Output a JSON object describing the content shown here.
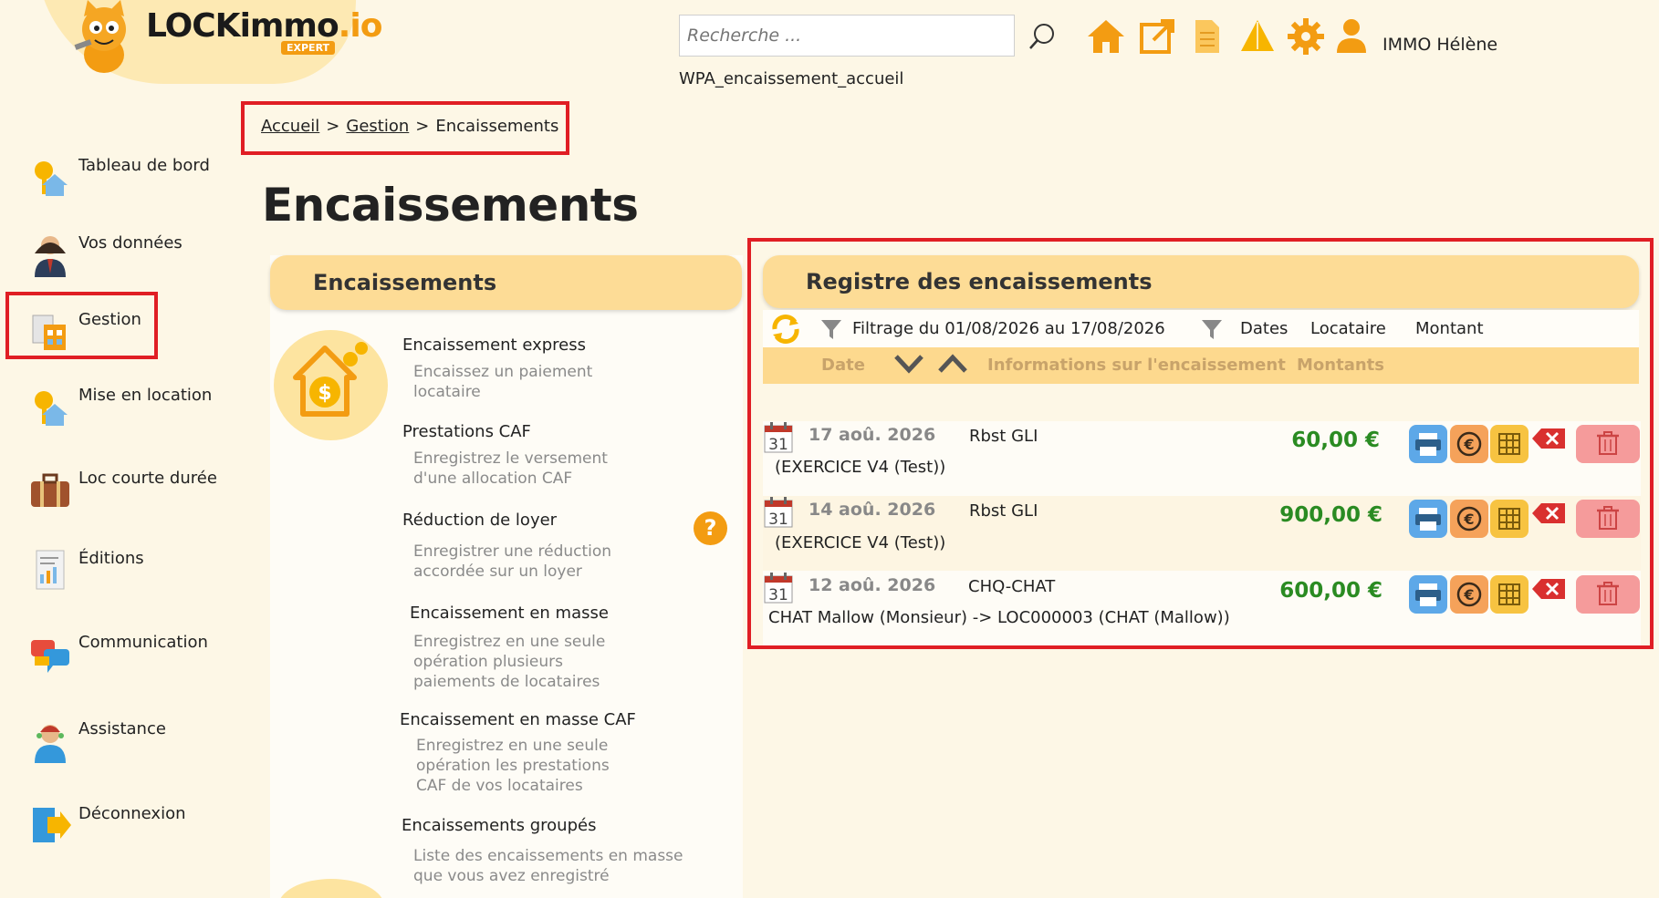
{
  "brand": {
    "name_main": "LOCKimmo",
    "name_suffix": ".io",
    "badge": "EXPERT"
  },
  "header": {
    "search_placeholder": "Recherche ...",
    "user_name": "IMMO Hélène",
    "page_code": "WPA_encaissement_accueil"
  },
  "breadcrumb": {
    "home": "Accueil",
    "section": "Gestion",
    "current": "Encaissements",
    "separator": ">"
  },
  "page_title": "Encaissements",
  "sidebar": {
    "items": [
      {
        "label": "Tableau de bord",
        "icon": "dashboard-icon"
      },
      {
        "label": "Vos données",
        "icon": "user-icon"
      },
      {
        "label": "Gestion",
        "icon": "management-icon"
      },
      {
        "label": "Mise en location",
        "icon": "rental-icon"
      },
      {
        "label": "Loc courte durée",
        "icon": "suitcase-icon"
      },
      {
        "label": "Éditions",
        "icon": "document-icon"
      },
      {
        "label": "Communication",
        "icon": "chat-icon"
      },
      {
        "label": "Assistance",
        "icon": "support-icon"
      },
      {
        "label": "Déconnexion",
        "icon": "logout-icon"
      }
    ]
  },
  "left_panel": {
    "title": "Encaissements",
    "menu": [
      {
        "title": "Encaissement express",
        "desc": "Encaissez un paiement locataire"
      },
      {
        "title": "Prestations CAF",
        "desc": "Enregistrez le versement d'une allocation CAF"
      },
      {
        "title": "Réduction de loyer",
        "desc": "Enregistrer une réduction accordée sur un loyer"
      },
      {
        "title": "Encaissement en masse",
        "desc": "Enregistrez en une seule opération plusieurs paiements de locataires"
      },
      {
        "title": "Encaissement en masse CAF",
        "desc": "Enregistrez en une seule opération les prestations CAF de vos locataires"
      },
      {
        "title": "Encaissements groupés",
        "desc": "Liste des encaissements en masse que vous avez enregistré"
      }
    ],
    "help": "?"
  },
  "register": {
    "title": "Registre des encaissements",
    "filter_text": "Filtrage du 01/08/2026 au 17/08/2026",
    "filter_dates": "Dates",
    "filter_tenant": "Locataire",
    "filter_amount": "Montant",
    "col_date": "Date",
    "col_info": "Informations sur l'encaissement",
    "col_amount": "Montants",
    "calendar_day": "31",
    "rows": [
      {
        "date": "17 aoû. 2026",
        "label": "Rbst GLI",
        "desc": "(EXERCICE V4 (Test))",
        "amount": "60,00 €"
      },
      {
        "date": "14 aoû. 2026",
        "label": "Rbst GLI",
        "desc": "(EXERCICE V4 (Test))",
        "amount": "900,00 €"
      },
      {
        "date": "12 aoû. 2026",
        "label": "CHQ-CHAT",
        "desc": "CHAT Mallow (Monsieur) -> LOC000003 (CHAT (Mallow))",
        "amount": "600,00 €"
      }
    ]
  },
  "colors": {
    "accent": "#f39c12",
    "highlight_border": "#e01e24",
    "panel_header": "#fddc96",
    "amount_green": "#2a8b22"
  }
}
